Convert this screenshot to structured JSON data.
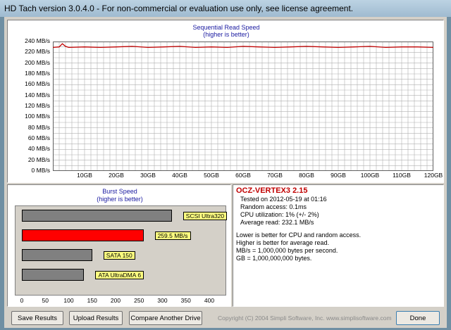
{
  "window": {
    "title": "HD Tach version 3.0.4.0  -  For non-commercial or evaluation use only, see license agreement."
  },
  "seq_chart": {
    "title": "Sequential Read Speed",
    "subtitle": "(higher is better)",
    "y_ticks": [
      "240 MB/s",
      "220 MB/s",
      "200 MB/s",
      "180 MB/s",
      "160 MB/s",
      "140 MB/s",
      "120 MB/s",
      "100 MB/s",
      "80 MB/s",
      "60 MB/s",
      "40 MB/s",
      "20 MB/s",
      "0 MB/s"
    ],
    "x_ticks": [
      "10GB",
      "20GB",
      "30GB",
      "40GB",
      "50GB",
      "60GB",
      "70GB",
      "80GB",
      "90GB",
      "100GB",
      "110GB",
      "120GB"
    ],
    "line_color": "#c00000",
    "grid_color": "#b0b0b0"
  },
  "burst_chart": {
    "title": "Burst Speed",
    "subtitle": "(higher is better)",
    "x_ticks": [
      "0",
      "50",
      "100",
      "150",
      "200",
      "250",
      "300",
      "350",
      "400"
    ],
    "highlight_color": "#ff0000",
    "reference_color": "#808080",
    "label_bg": "#ffff80"
  },
  "info": {
    "drive_name": "OCZ-VERTEX3 2.15",
    "tested_on": "Tested on 2012-05-19 at 01:16",
    "random_access": "Random access: 0.1ms",
    "cpu_util": "CPU utilization: 1% (+/- 2%)",
    "avg_read": "Average read: 232.1 MB/s",
    "note1": "Lower is better for CPU and random access.",
    "note2": "Higher is better for average read.",
    "note3": "MB/s = 1,000,000 bytes per second.",
    "note4": "GB = 1,000,000,000 bytes."
  },
  "buttons": {
    "save_results": "Save Results",
    "upload_results": "Upload Results",
    "compare_drive": "Compare Another Drive",
    "done": "Done"
  },
  "footer": {
    "copyright": "Copyright (C) 2004 Simpli Software, Inc. www.simplisoftware.com"
  },
  "chart_data": [
    {
      "type": "line",
      "title": "Sequential Read Speed",
      "subtitle": "(higher is better)",
      "xlabel": "",
      "ylabel": "",
      "xlim": [
        0,
        120
      ],
      "ylim": [
        0,
        240
      ],
      "x_unit": "GB",
      "y_unit": "MB/s",
      "grid": true,
      "series": [
        {
          "x": [
            0,
            2,
            3,
            4,
            5,
            10,
            15,
            20,
            25,
            30,
            35,
            40,
            45,
            50,
            55,
            60,
            65,
            70,
            75,
            80,
            85,
            90,
            95,
            100,
            105,
            110,
            115,
            120
          ],
          "y": [
            229,
            230,
            236,
            231,
            229,
            230,
            229,
            230,
            231,
            229,
            230,
            231,
            229,
            230,
            229,
            231,
            230,
            229,
            230,
            231,
            230,
            229,
            230,
            231,
            229,
            230,
            230,
            229
          ]
        }
      ]
    },
    {
      "type": "bar",
      "orientation": "horizontal",
      "title": "Burst Speed",
      "subtitle": "(higher is better)",
      "xlim": [
        0,
        400
      ],
      "categories": [
        "SCSI Ultra320",
        "259.5 MB/s",
        "SATA 150",
        "ATA UltraDMA 6"
      ],
      "values": [
        320,
        259.5,
        150,
        133
      ]
    }
  ]
}
